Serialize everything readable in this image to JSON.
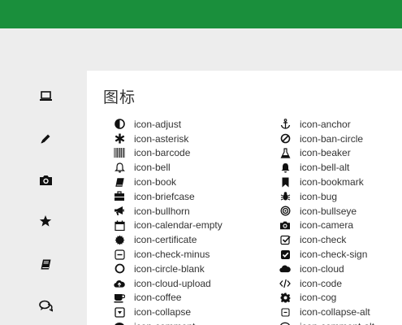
{
  "panel": {
    "title": "图标"
  },
  "sidebar": {
    "icons": [
      "laptop-icon",
      "pencil-icon",
      "camera-icon",
      "star-icon",
      "book-icon",
      "comments-icon"
    ]
  },
  "icons_left": [
    {
      "icon": "adjust-icon",
      "label": "icon-adjust"
    },
    {
      "icon": "asterisk-icon",
      "label": "icon-asterisk"
    },
    {
      "icon": "barcode-icon",
      "label": "icon-barcode"
    },
    {
      "icon": "bell-icon",
      "label": "icon-bell"
    },
    {
      "icon": "book-icon",
      "label": "icon-book"
    },
    {
      "icon": "briefcase-icon",
      "label": "icon-briefcase"
    },
    {
      "icon": "bullhorn-icon",
      "label": "icon-bullhorn"
    },
    {
      "icon": "calendar-empty-icon",
      "label": "icon-calendar-empty"
    },
    {
      "icon": "certificate-icon",
      "label": "icon-certificate"
    },
    {
      "icon": "check-minus-icon",
      "label": "icon-check-minus"
    },
    {
      "icon": "circle-blank-icon",
      "label": "icon-circle-blank"
    },
    {
      "icon": "cloud-upload-icon",
      "label": "icon-cloud-upload"
    },
    {
      "icon": "coffee-icon",
      "label": "icon-coffee"
    },
    {
      "icon": "collapse-icon",
      "label": "icon-collapse"
    },
    {
      "icon": "comment-icon",
      "label": "icon-comment"
    }
  ],
  "icons_right": [
    {
      "icon": "anchor-icon",
      "label": "icon-anchor"
    },
    {
      "icon": "ban-circle-icon",
      "label": "icon-ban-circle"
    },
    {
      "icon": "beaker-icon",
      "label": "icon-beaker"
    },
    {
      "icon": "bell-alt-icon",
      "label": "icon-bell-alt"
    },
    {
      "icon": "bookmark-icon",
      "label": "icon-bookmark"
    },
    {
      "icon": "bug-icon",
      "label": "icon-bug"
    },
    {
      "icon": "bullseye-icon",
      "label": "icon-bullseye"
    },
    {
      "icon": "camera-icon",
      "label": "icon-camera"
    },
    {
      "icon": "check-icon",
      "label": "icon-check"
    },
    {
      "icon": "check-sign-icon",
      "label": "icon-check-sign"
    },
    {
      "icon": "cloud-icon",
      "label": "icon-cloud"
    },
    {
      "icon": "code-icon",
      "label": "icon-code"
    },
    {
      "icon": "cog-icon",
      "label": "icon-cog"
    },
    {
      "icon": "collapse-alt-icon",
      "label": "icon-collapse-alt"
    },
    {
      "icon": "comment-alt-icon",
      "label": "icon-comment-alt"
    }
  ],
  "colors": {
    "topbar": "#1a8f3c",
    "background": "#ededed",
    "panel": "#ffffff",
    "icon": "#111111"
  }
}
